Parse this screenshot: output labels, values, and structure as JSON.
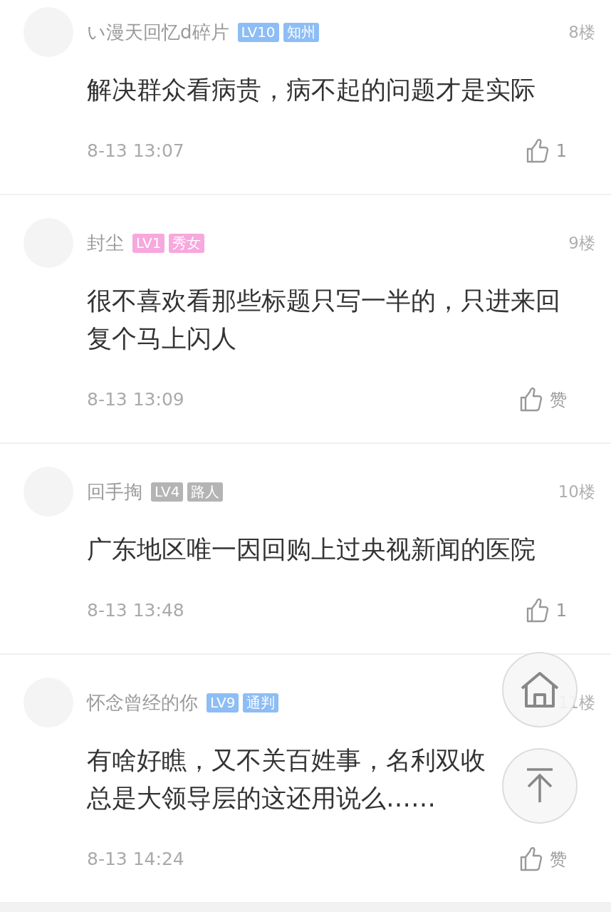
{
  "comments": [
    {
      "name": "い漫天回忆d碎片",
      "badges": [
        {
          "text": "LV10",
          "color": "#8dbdf5"
        },
        {
          "text": "知州",
          "color": "#8dbdf5"
        }
      ],
      "floor": "8楼",
      "body": "解决群众看病贵，病不起的问题才是实际",
      "time": "8-13 13:07",
      "likes": "1"
    },
    {
      "name": "封尘",
      "badges": [
        {
          "text": "LV1",
          "color": "#f7a8dd"
        },
        {
          "text": "秀女",
          "color": "#f7a8dd"
        }
      ],
      "floor": "9楼",
      "body": "很不喜欢看那些标题只写一半的，只进来回复个马上闪人",
      "time": "8-13 13:09",
      "likes": "赞"
    },
    {
      "name": "回手掏",
      "badges": [
        {
          "text": "LV4",
          "color": "#b4b4b4"
        },
        {
          "text": "路人",
          "color": "#b4b4b4"
        }
      ],
      "floor": "10楼",
      "body": "广东地区唯一因回购上过央视新闻的医院",
      "time": "8-13 13:48",
      "likes": "1"
    },
    {
      "name": "怀念曾经的你",
      "badges": [
        {
          "text": "LV9",
          "color": "#8dbdf5"
        },
        {
          "text": "通判",
          "color": "#8dbdf5"
        }
      ],
      "floor": "11楼",
      "body": "有啥好瞧，又不关百姓事，名利双收总是大领导层的这还用说么……",
      "time": "8-13 14:24",
      "likes": "赞"
    }
  ]
}
